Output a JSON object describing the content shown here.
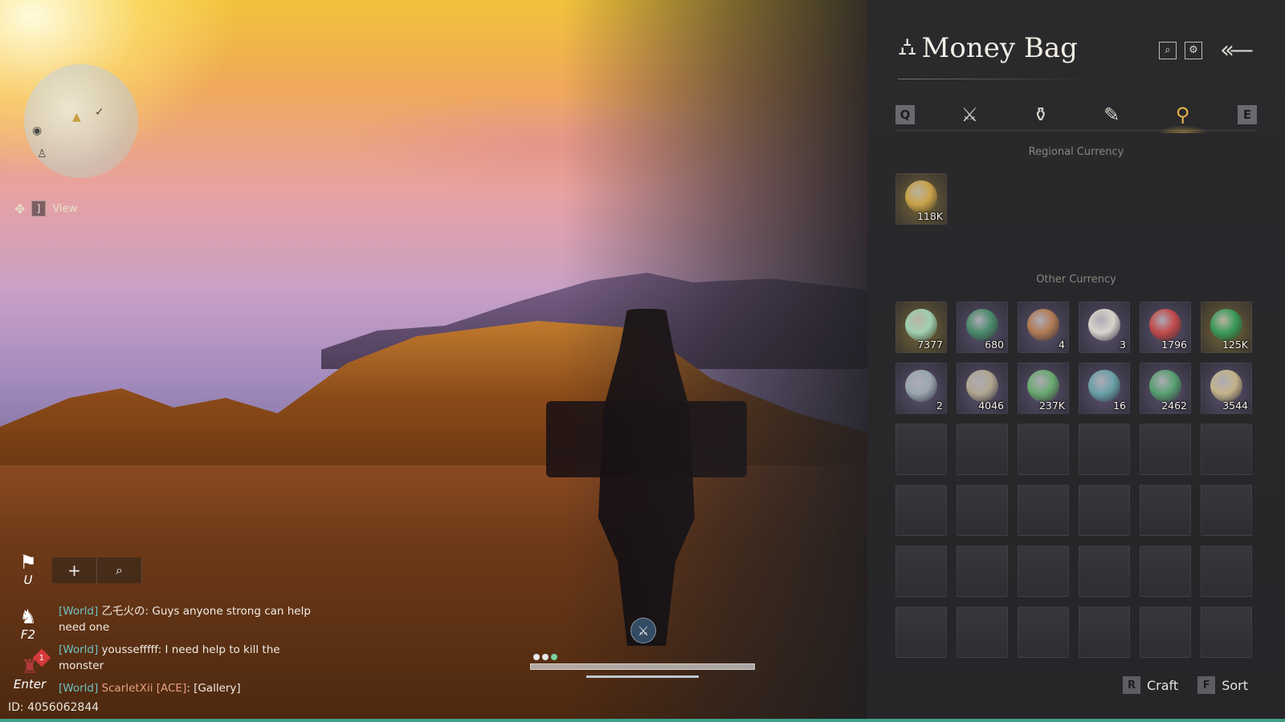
{
  "hud": {
    "view_key": "]",
    "view_label": "View",
    "flag_key": "U",
    "emote_key": "F2",
    "chat_key": "Enter",
    "notification_count": "1",
    "player_id": "ID: 4056062844"
  },
  "chat": {
    "messages": [
      {
        "channel": "[World]",
        "name": "乙乇火の",
        "text": ": Guys anyone strong can help need one"
      },
      {
        "channel": "[World]",
        "name": "youssefffff",
        "text": ": I need help to kill the monster"
      },
      {
        "channel": "[World]",
        "name": "ScarletXii [ACE]",
        "text": ": [Gallery]"
      }
    ]
  },
  "panel": {
    "title": "Money Bag",
    "tab_prev_key": "Q",
    "tab_next_key": "E",
    "regional_label": "Regional Currency",
    "other_label": "Other Currency",
    "regional_items": [
      {
        "name": "coin-stack",
        "qty": "118K",
        "color": "#c9a24a"
      }
    ],
    "other_items": [
      {
        "name": "jade-ring",
        "qty": "7377",
        "color": "#9fd0b0"
      },
      {
        "name": "spirit-wisp",
        "qty": "680",
        "color": "#4a8a6a"
      },
      {
        "name": "bronze-tablet",
        "qty": "4",
        "color": "#b07a52"
      },
      {
        "name": "silver-slips",
        "qty": "3",
        "color": "#d8d4cc"
      },
      {
        "name": "crimson-wisp",
        "qty": "1796",
        "color": "#c04a4a"
      },
      {
        "name": "green-jade-ring",
        "qty": "125K",
        "color": "#3a9a5a"
      },
      {
        "name": "fish-token",
        "qty": "2",
        "color": "#9aa6b0"
      },
      {
        "name": "bronze-key",
        "qty": "4046",
        "color": "#b0a690"
      },
      {
        "name": "green-ticket",
        "qty": "237K",
        "color": "#6aa870"
      },
      {
        "name": "jade-stone",
        "qty": "16",
        "color": "#6aa0a8"
      },
      {
        "name": "green-note",
        "qty": "2462",
        "color": "#58a070"
      },
      {
        "name": "square-hole-coin",
        "qty": "3544",
        "color": "#c4b48a"
      }
    ],
    "craft_key": "R",
    "craft_label": "Craft",
    "sort_key": "F",
    "sort_label": "Sort"
  }
}
